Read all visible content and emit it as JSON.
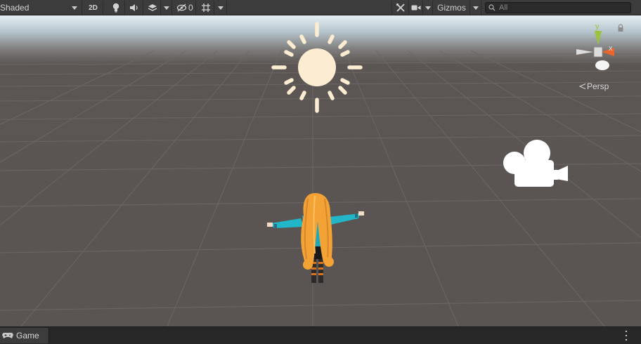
{
  "toolbar": {
    "shading_mode": "Shaded",
    "mode_2d_label": "2D",
    "hidden_count": "0",
    "gizmos_label": "Gizmos",
    "search_placeholder": "All"
  },
  "scene": {
    "projection_label": "Persp",
    "gizmo_axes": {
      "y": "y",
      "x": "x"
    },
    "colors": {
      "sky": "#e6eef2",
      "ground": "#5a5452",
      "grid_line": "#6e6967",
      "sun": "#fcecd2",
      "axis_y": "#9bc33c",
      "axis_x": "#e8662e"
    },
    "icons": [
      "sun-icon",
      "camera-icon",
      "scene-gizmo"
    ]
  },
  "bottom_panel": {
    "tab_label": "Game",
    "tab_icon": "gamepad-icon"
  }
}
